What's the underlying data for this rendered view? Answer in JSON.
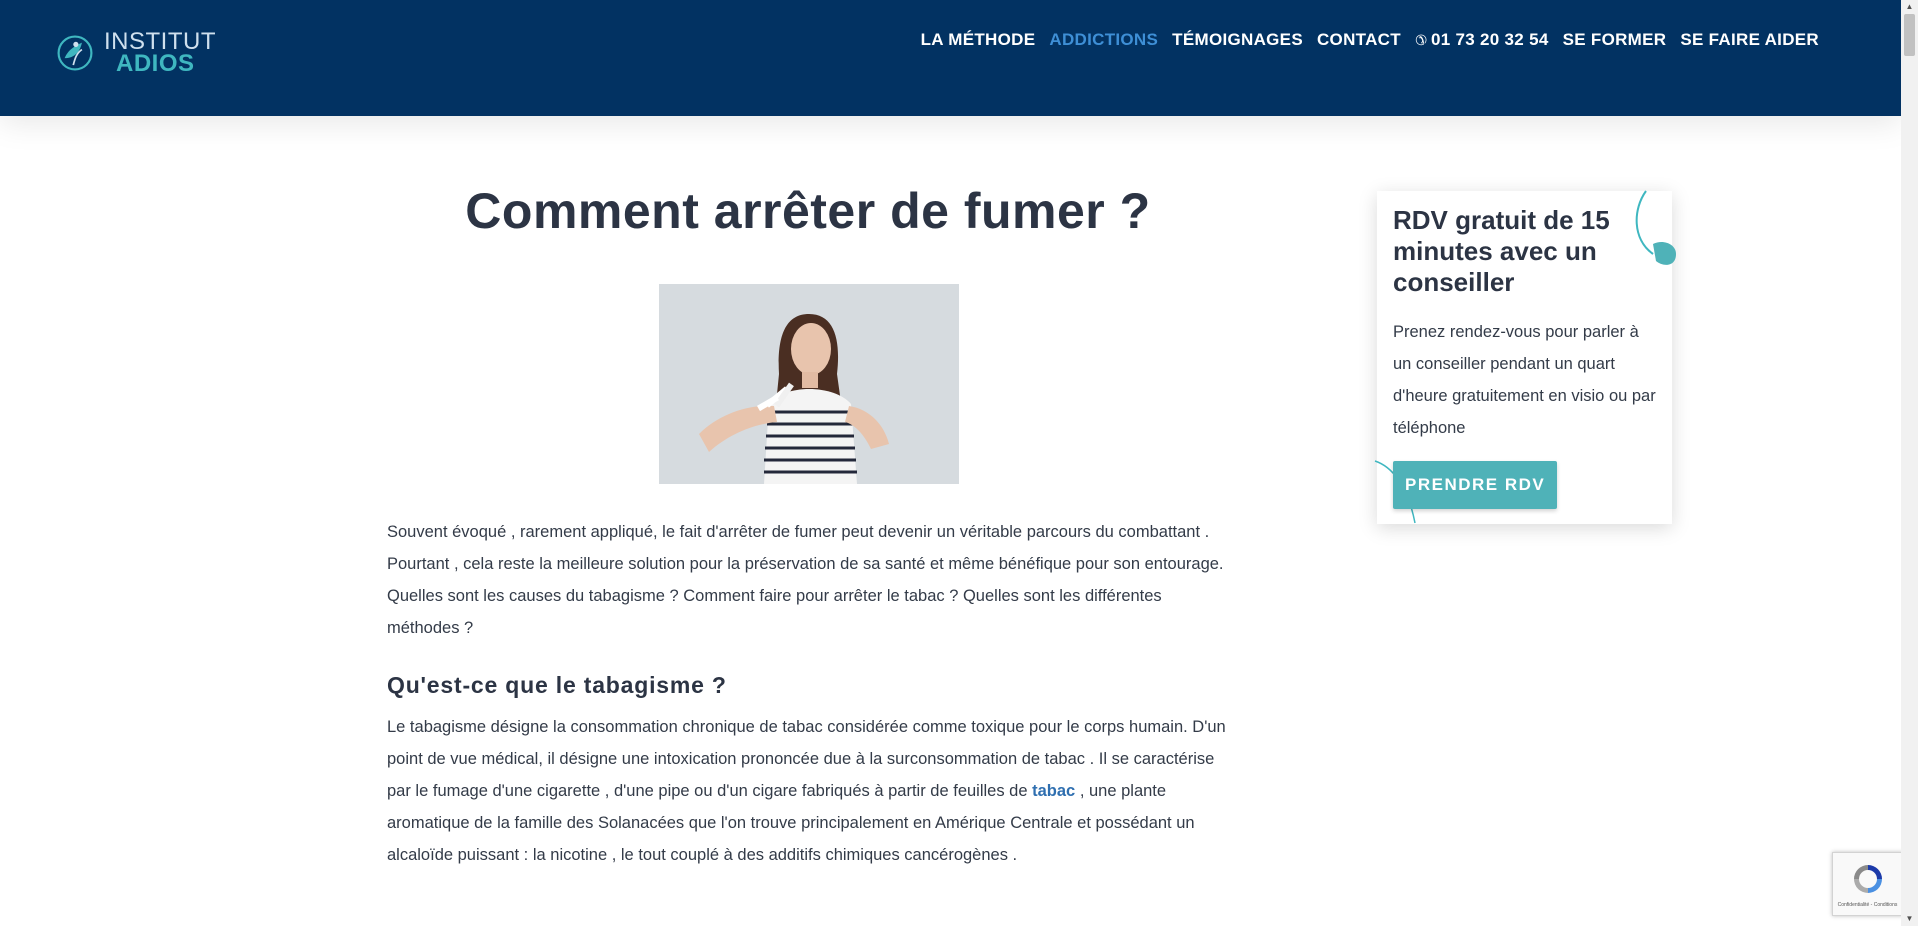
{
  "brand": {
    "line1": "INSTITUT",
    "line2": "ADIOS",
    "colors": {
      "navy": "#023262",
      "teal": "#3fb7c0",
      "accent": "#3e8fd6",
      "button": "#4fb2b8"
    }
  },
  "nav": {
    "items": [
      {
        "label": "LA MÉTHODE",
        "active": false
      },
      {
        "label": "ADDICTIONS",
        "active": true
      },
      {
        "label": "TÉMOIGNAGES",
        "active": false
      },
      {
        "label": "CONTACT",
        "active": false
      },
      {
        "label": "01 73 20 32 54",
        "active": false,
        "icon": "phone-icon"
      },
      {
        "label": "SE FORMER",
        "active": false
      },
      {
        "label": "SE FAIRE AIDER",
        "active": false
      }
    ]
  },
  "article": {
    "title": "Comment arrêter de fumer ?",
    "intro": "Souvent évoqué , rarement appliqué, le fait d'arrêter de fumer peut devenir un véritable parcours du combattant . Pourtant , cela reste la meilleure solution pour la préservation de sa santé et même bénéfique pour son entourage. Quelles sont les causes du tabagisme ? Comment faire pour arrêter le tabac ? Quelles sont les différentes méthodes ?",
    "section_title": "Qu'est-ce que le tabagisme ?",
    "section_text_before": "Le tabagisme désigne la consommation chronique de tabac considérée comme toxique pour le corps humain. D'un point de vue médical, il désigne une intoxication prononcée due à la surconsommation de tabac . Il se caractérise par le fumage d'une cigarette , d'une pipe ou d'un cigare fabriqués à partir de feuilles de ",
    "section_link": "tabac",
    "section_text_after": " , une plante aromatique de la famille des Solanacées que l'on trouve principalement en Amérique Centrale et possédant un alcaloïde puissant : la nicotine , le tout couplé à des additifs chimiques cancérogènes ."
  },
  "sidebar": {
    "title": "RDV gratuit de 15 minutes avec un conseiller",
    "text": "Prenez rendez-vous pour parler à un conseiller pendant un quart d'heure gratuitement en visio ou par téléphone",
    "button": "PRENDRE RDV"
  },
  "recaptcha": {
    "links": "Confidentialité - Conditions"
  }
}
